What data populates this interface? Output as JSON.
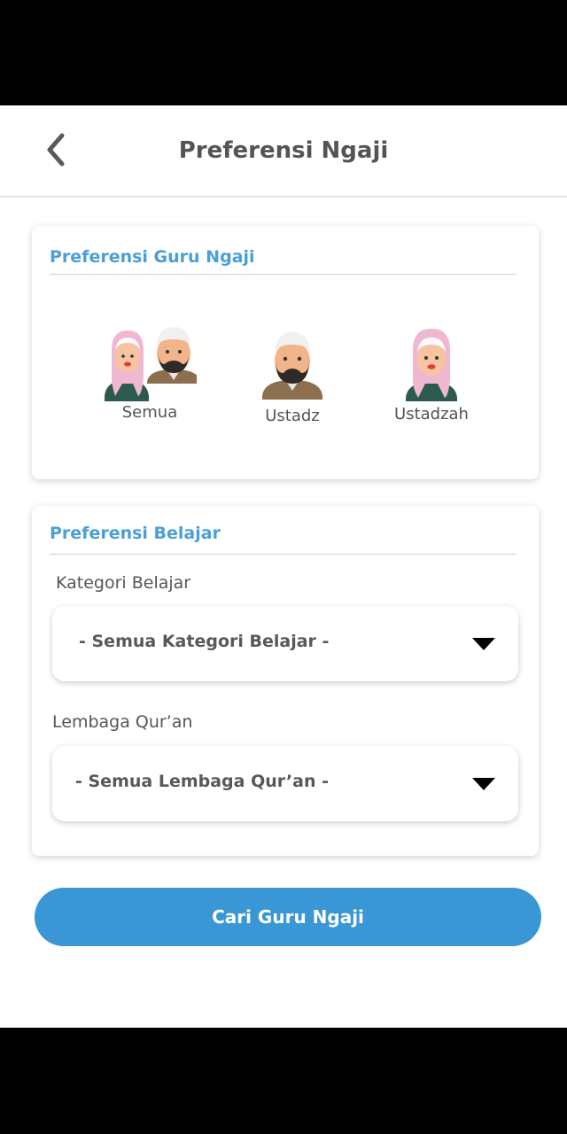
{
  "header": {
    "title": "Preferensi Ngaji",
    "back_icon": "chevron-left-icon"
  },
  "guru_card": {
    "title": "Preferensi Guru Ngaji",
    "options": [
      {
        "label": "Semua",
        "icon": "couple-avatar-icon"
      },
      {
        "label": "Ustadz",
        "icon": "male-teacher-avatar-icon"
      },
      {
        "label": "Ustadzah",
        "icon": "female-teacher-avatar-icon"
      }
    ]
  },
  "belajar_card": {
    "title": "Preferensi Belajar",
    "kategori_label": "Kategori Belajar",
    "kategori_value": "- Semua Kategori Belajar -",
    "lembaga_label": "Lembaga Qur’an",
    "lembaga_value": "- Semua Lembaga Qur’an -"
  },
  "search_button": {
    "label": "Cari Guru Ngaji"
  },
  "colors": {
    "accent": "#3a97d6",
    "section_title": "#4a9fd8",
    "text": "#545454"
  }
}
